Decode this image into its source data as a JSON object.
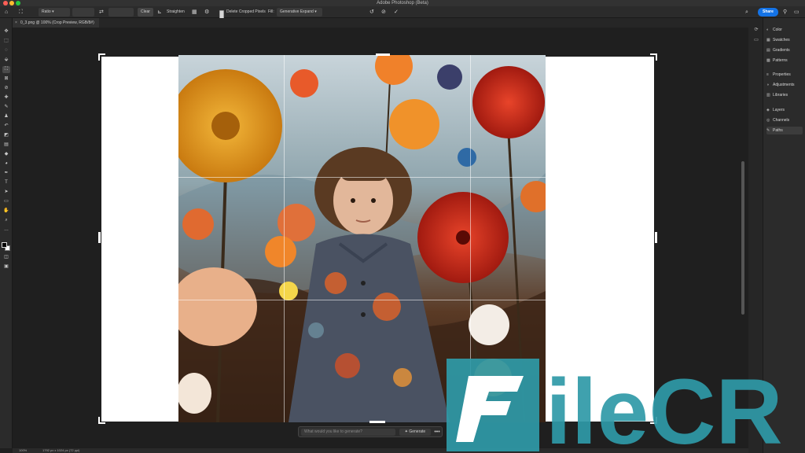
{
  "window": {
    "title": "Adobe Photoshop (Beta)"
  },
  "options_bar": {
    "ratio_label": "Ratio",
    "clear_label": "Clear",
    "straighten_label": "Straighten",
    "delete_cropped_label": "Delete Cropped Pixels",
    "fill_label": "Fill:",
    "fill_value": "Generative Expand",
    "share_label": "Share"
  },
  "document": {
    "tab_title": "0_3.png @ 100% (Crop Preview, RGB/8#)"
  },
  "contextual_taskbar": {
    "prompt_placeholder": "What would you like to generate?",
    "generate_label": "Generate",
    "more_label": "•••"
  },
  "status_bar": {
    "zoom": "100%",
    "doc_info": "1792 px x 1024 px (72 ppi)"
  },
  "panels": [
    {
      "label": "Color",
      "icon": "color-icon"
    },
    {
      "label": "Swatches",
      "icon": "swatches-icon"
    },
    {
      "label": "Gradients",
      "icon": "gradients-icon"
    },
    {
      "label": "Patterns",
      "icon": "patterns-icon"
    },
    {
      "label": "Properties",
      "icon": "properties-icon"
    },
    {
      "label": "Adjustments",
      "icon": "adjustments-icon"
    },
    {
      "label": "Libraries",
      "icon": "libraries-icon"
    },
    {
      "label": "Layers",
      "icon": "layers-icon"
    },
    {
      "label": "Channels",
      "icon": "channels-icon"
    },
    {
      "label": "Paths",
      "icon": "paths-icon"
    }
  ],
  "watermark": {
    "text": "FileCR"
  },
  "colors": {
    "accent": "#1473e6",
    "watermark": "#2f9aa8",
    "canvas_fill": "#ffffff",
    "ui_dark": "#2b2b2b"
  }
}
